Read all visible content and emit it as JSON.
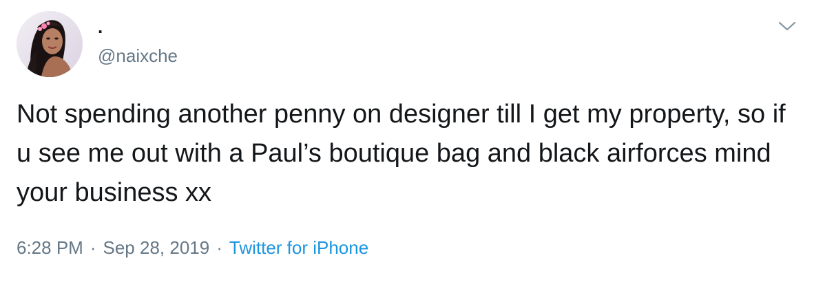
{
  "tweet": {
    "display_name": ".",
    "handle": "@naixche",
    "text": "Not spending another penny on designer till I get my property, so if u see me out with a Paul’s boutique bag and black airforces mind your business xx",
    "time": "6:28 PM",
    "separator": "·",
    "date": "Sep 28, 2019",
    "source": "Twitter for iPhone"
  },
  "icons": {
    "menu": "chevron-down-icon",
    "avatar": "avatar"
  },
  "colors": {
    "text": "#14171a",
    "secondary": "#657786",
    "link": "#1b95e0",
    "background": "#ffffff"
  }
}
